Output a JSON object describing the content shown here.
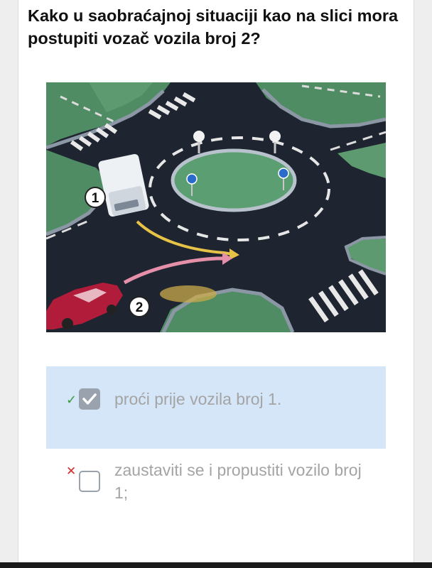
{
  "question": {
    "text": "Kako u saobraćajnoj situaciji kao na slici mora postupiti vozač vozila broj 2?"
  },
  "figure": {
    "vehicle_1_label": "1",
    "vehicle_2_label": "2"
  },
  "answers": [
    {
      "text": "proći prije vozila broj 1.",
      "checked": true,
      "result_mark": "✓",
      "highlight_color": "#d4e6f8"
    },
    {
      "text": "zaustaviti se i propustiti vozilo broj 1;",
      "checked": false,
      "result_mark": "✕"
    }
  ],
  "colors": {
    "correct": "#3c9a3c",
    "incorrect": "#d22b2b",
    "answer_text": "#a4a4a4"
  }
}
